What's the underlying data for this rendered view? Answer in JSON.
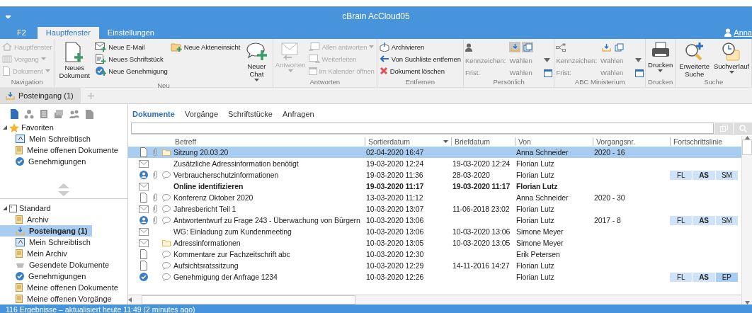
{
  "window": {
    "title": "cBrain AcCloud05"
  },
  "ribbon_tabs": [
    {
      "label": "F2",
      "selected": false
    },
    {
      "label": "Hauptfenster",
      "selected": true
    },
    {
      "label": "Einstellungen",
      "selected": false
    }
  ],
  "user": {
    "name": "Anna"
  },
  "ribbon_groups": [
    {
      "label": "Navigation",
      "columns": [
        {
          "kind": "small",
          "items": [
            {
              "label": "Hauptfenster",
              "disabled": true,
              "dropdown": false
            },
            {
              "label": "Vorgang",
              "disabled": true,
              "dropdown": true
            },
            {
              "label": "Dokument",
              "disabled": true,
              "dropdown": true
            }
          ]
        }
      ]
    },
    {
      "label": "Neu",
      "columns": [
        {
          "kind": "large",
          "label": "Neues Dokument",
          "disabled": false,
          "dropdown": false
        },
        {
          "kind": "small",
          "items": [
            {
              "label": "Neue E-Mail",
              "disabled": false,
              "dropdown": false
            },
            {
              "label": "Neues Schriftstück",
              "disabled": false,
              "dropdown": false
            },
            {
              "label": "Neue Genehmigung",
              "disabled": false,
              "dropdown": false
            }
          ]
        },
        {
          "kind": "small",
          "items": [
            {
              "label": "Neue Akteneinsicht",
              "disabled": false,
              "dropdown": false
            }
          ]
        },
        {
          "kind": "large",
          "label": "Neuer Chat",
          "disabled": false,
          "dropdown": true
        }
      ]
    },
    {
      "label": "Antworten",
      "columns": [
        {
          "kind": "large",
          "label": "Antworten",
          "disabled": true,
          "dropdown": true
        },
        {
          "kind": "small",
          "items": [
            {
              "label": "Allen antworten",
              "disabled": true,
              "dropdown": true
            },
            {
              "label": "Weiterleiten",
              "disabled": true,
              "dropdown": false
            },
            {
              "label": "Im Kalender öffnen",
              "disabled": true,
              "dropdown": false
            }
          ]
        }
      ]
    },
    {
      "label": "Entfernen",
      "columns": [
        {
          "kind": "small",
          "items": [
            {
              "label": "Archivieren",
              "disabled": false,
              "dropdown": false
            },
            {
              "label": "Von Suchliste entfernen",
              "disabled": false,
              "dropdown": false
            },
            {
              "label": "Dokument löschen",
              "disabled": false,
              "dropdown": false
            }
          ]
        }
      ]
    },
    {
      "label": "Persönlich",
      "columns": [
        {
          "kind": "fields",
          "toggles": [
            {
              "selected": true
            },
            {
              "selected": true
            }
          ],
          "rows": [
            {
              "label": "Kennzeichen:",
              "value": "Wählen"
            },
            {
              "label": "Frist:",
              "value": "Wählen"
            }
          ]
        }
      ]
    },
    {
      "label": "ABC Ministerium",
      "columns": [
        {
          "kind": "fields",
          "toggles": [
            {
              "selected": false
            },
            {
              "selected": false
            }
          ],
          "rows": [
            {
              "label": "Kennzeichen:",
              "value": "Wählen"
            },
            {
              "label": "Frist:",
              "value": "Wählen"
            }
          ]
        }
      ]
    },
    {
      "label": "Drucken",
      "columns": [
        {
          "kind": "large",
          "label": "Drucken",
          "disabled": false,
          "dropdown": true
        }
      ]
    },
    {
      "label": "Suche",
      "columns": [
        {
          "kind": "large",
          "label": "Erweiterte Suche",
          "disabled": false,
          "dropdown": false
        },
        {
          "kind": "large",
          "label": "Suchverlauf",
          "disabled": false,
          "dropdown": true
        }
      ]
    }
  ],
  "doc_tabs": [
    {
      "label": "Posteingang (1)",
      "selected": true
    }
  ],
  "sidebar": {
    "sections": [
      {
        "label": "Favoriten",
        "expanded": true,
        "items": [
          {
            "label": "Mein Schreibtisch",
            "selected": false
          },
          {
            "label": "Meine offenen Dokumente",
            "selected": false
          },
          {
            "label": "Genehmigungen",
            "selected": false
          }
        ]
      },
      {
        "label": "Standard",
        "expanded": true,
        "items": [
          {
            "label": "Archiv",
            "selected": false
          },
          {
            "label": "Posteingang (1)",
            "selected": true
          },
          {
            "label": "Mein Schreibtisch",
            "selected": false
          },
          {
            "label": "Mein Archiv",
            "selected": false
          },
          {
            "label": "Gesendete Dokumente",
            "selected": false
          },
          {
            "label": "Genehmigungen",
            "selected": false
          },
          {
            "label": "Meine offenen Dokumente",
            "selected": false
          },
          {
            "label": "Meine offenen Vorgänge",
            "selected": false
          }
        ]
      }
    ]
  },
  "content_tabs": [
    {
      "label": "Dokumente",
      "selected": true
    },
    {
      "label": "Vorgänge",
      "selected": false
    },
    {
      "label": "Schriftstücke",
      "selected": false
    },
    {
      "label": "Anfragen",
      "selected": false
    }
  ],
  "table": {
    "columns": [
      {
        "label": "Betreff",
        "sorted": false
      },
      {
        "label": "Sortierdatum",
        "sorted": true
      },
      {
        "label": "Briefdatum",
        "sorted": false
      },
      {
        "label": "Von",
        "sorted": false
      },
      {
        "label": "Vorgangsnr.",
        "sorted": false
      },
      {
        "label": "Fortschrittslinie",
        "sorted": false
      }
    ],
    "rows": [
      {
        "kind": "document",
        "attachment": true,
        "comment": false,
        "folder": true,
        "subject": "Sitzung 20.03.20",
        "sort_date": "02-04-2020 16:47",
        "letter_date": "",
        "from": "Anna Schneider",
        "case_no": "2020 - 16",
        "progress": [],
        "selected": true,
        "unread": false
      },
      {
        "kind": "mail",
        "attachment": false,
        "comment": false,
        "folder": false,
        "subject": "Zusätzliche Adressinformation benötigt",
        "sort_date": "19-03-2020 12:24",
        "letter_date": "19-03-2020 12:24",
        "from": "Florian Lutz",
        "case_no": "",
        "progress": [],
        "selected": false,
        "unread": false
      },
      {
        "kind": "request",
        "attachment": true,
        "comment": true,
        "folder": false,
        "subject": "Verbraucherschutzinformationen",
        "sort_date": "19-03-2020 11:36",
        "letter_date": "28-03-2020",
        "from": "Florian Lutz",
        "case_no": "",
        "progress": [
          {
            "label": "FL",
            "current": false
          },
          {
            "label": "AS",
            "current": false
          },
          {
            "label": "SM",
            "current": false
          }
        ],
        "selected": false,
        "unread": false
      },
      {
        "kind": "mail",
        "attachment": false,
        "comment": false,
        "folder": false,
        "subject": "Online identifizieren",
        "sort_date": "19-03-2020 11:17",
        "letter_date": "19-03-2020 11:17",
        "from": "Florian Lutz",
        "case_no": "",
        "progress": [],
        "selected": false,
        "unread": true
      },
      {
        "kind": "document",
        "attachment": true,
        "comment": true,
        "folder": false,
        "subject": "Konferenz Oktober 2020",
        "sort_date": "13-03-2020 11:12",
        "letter_date": "",
        "from": "Anna Schneider",
        "case_no": "2020 - 30",
        "progress": [],
        "selected": false,
        "unread": false
      },
      {
        "kind": "mail",
        "attachment": true,
        "comment": true,
        "folder": false,
        "subject": "Jahresbericht Teil 1",
        "sort_date": "10-03-2020 13:07",
        "letter_date": "11-06-2018 23:02",
        "from": "Florian Lutz",
        "case_no": "",
        "progress": [],
        "selected": false,
        "unread": false
      },
      {
        "kind": "request",
        "attachment": true,
        "comment": true,
        "folder": false,
        "subject": "Antwortentwurf zu Frage 243 - Überwachung von Bürgern",
        "sort_date": "10-03-2020 13:06",
        "letter_date": "",
        "from": "Florian Lutz",
        "case_no": "2017 - 8",
        "progress": [
          {
            "label": "FL",
            "current": false
          },
          {
            "label": "AS",
            "current": false
          },
          {
            "label": "SM",
            "current": false
          }
        ],
        "selected": false,
        "unread": false
      },
      {
        "kind": "mail",
        "attachment": false,
        "comment": false,
        "folder": false,
        "subject": "WG: Einladung zum Kundenmeeting",
        "sort_date": "10-03-2020 13:06",
        "letter_date": "10-03-2020 13:06",
        "from": "Simone Meyer",
        "case_no": "",
        "progress": [],
        "selected": false,
        "unread": false
      },
      {
        "kind": "mail",
        "attachment": false,
        "comment": false,
        "folder": true,
        "subject": "Adressinformationen",
        "sort_date": "10-03-2020 13:05",
        "letter_date": "10-03-2020 13:05",
        "from": "Simone Meyer",
        "case_no": "",
        "progress": [],
        "selected": false,
        "unread": false
      },
      {
        "kind": "document",
        "attachment": false,
        "comment": true,
        "folder": false,
        "subject": "Kommentare zur Fachzeitschrift abc",
        "sort_date": "10-03-2020 12:30",
        "letter_date": "",
        "from": "Erik Petersen",
        "case_no": "",
        "progress": [],
        "selected": false,
        "unread": false
      },
      {
        "kind": "document",
        "attachment": false,
        "comment": true,
        "folder": false,
        "subject": "Aufsichtsratssitzung",
        "sort_date": "10-03-2020 12:29",
        "letter_date": "14-11-2016 14:27",
        "from": "Florian Lutz",
        "case_no": "",
        "progress": [],
        "selected": false,
        "unread": false
      },
      {
        "kind": "approval",
        "attachment": false,
        "comment": true,
        "folder": false,
        "subject": "Genehmigung der Anfrage 1234",
        "sort_date": "10-03-2020 12:26",
        "letter_date": "",
        "from": "Florian Lutz",
        "case_no": "",
        "progress": [
          {
            "label": "FL",
            "current": false
          },
          {
            "label": "AS",
            "current": false
          },
          {
            "label": "EP",
            "current": true
          }
        ],
        "selected": false,
        "unread": false
      }
    ]
  },
  "status_bar": {
    "text": "116 Ergebnisse – aktualisiert heute 11:49 (2 minutes ago)"
  }
}
